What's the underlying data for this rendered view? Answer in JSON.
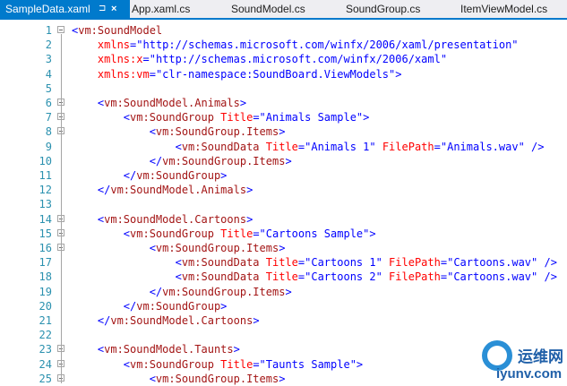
{
  "tabs": [
    {
      "label": "SampleData.xaml",
      "active": true
    },
    {
      "label": "App.xaml.cs",
      "active": false
    },
    {
      "label": "SoundModel.cs",
      "active": false
    },
    {
      "label": "SoundGroup.cs",
      "active": false
    },
    {
      "label": "ItemViewModel.cs",
      "active": false
    }
  ],
  "tab_icons": {
    "pin": "⊐",
    "close": "×"
  },
  "colors": {
    "accent": "#007acc",
    "line_number": "#2b91af",
    "tag": "#a31515",
    "attr": "#ff0000",
    "value": "#0000ff"
  },
  "lines": [
    {
      "n": "1",
      "fold": true,
      "tokens": [
        [
          "br",
          "<"
        ],
        [
          "tag",
          "vm:SoundModel"
        ]
      ]
    },
    {
      "n": "2",
      "fold": false,
      "tokens": [
        [
          "at",
          "    xmlns"
        ],
        [
          "eq",
          "="
        ],
        [
          "val",
          "\"http://schemas.microsoft.com/winfx/2006/xaml/presentation\""
        ]
      ]
    },
    {
      "n": "3",
      "fold": false,
      "tokens": [
        [
          "at",
          "    xmlns:x"
        ],
        [
          "eq",
          "="
        ],
        [
          "val",
          "\"http://schemas.microsoft.com/winfx/2006/xaml\""
        ]
      ]
    },
    {
      "n": "4",
      "fold": false,
      "tokens": [
        [
          "at",
          "    xmlns:vm"
        ],
        [
          "eq",
          "="
        ],
        [
          "val",
          "\"clr-namespace:SoundBoard.ViewModels\""
        ],
        [
          "br",
          ">"
        ]
      ]
    },
    {
      "n": "5",
      "fold": false,
      "tokens": []
    },
    {
      "n": "6",
      "fold": true,
      "tokens": [
        [
          "br",
          "    <"
        ],
        [
          "tag",
          "vm:SoundModel.Animals"
        ],
        [
          "br",
          ">"
        ]
      ]
    },
    {
      "n": "7",
      "fold": true,
      "tokens": [
        [
          "br",
          "        <"
        ],
        [
          "tag",
          "vm:SoundGroup"
        ],
        [
          "at",
          " Title"
        ],
        [
          "eq",
          "="
        ],
        [
          "val",
          "\"Animals Sample\""
        ],
        [
          "br",
          ">"
        ]
      ]
    },
    {
      "n": "8",
      "fold": true,
      "tokens": [
        [
          "br",
          "            <"
        ],
        [
          "tag",
          "vm:SoundGroup.Items"
        ],
        [
          "br",
          ">"
        ]
      ]
    },
    {
      "n": "9",
      "fold": false,
      "tokens": [
        [
          "br",
          "                <"
        ],
        [
          "tag",
          "vm:SoundData"
        ],
        [
          "at",
          " Title"
        ],
        [
          "eq",
          "="
        ],
        [
          "val",
          "\"Animals 1\""
        ],
        [
          "at",
          " FilePath"
        ],
        [
          "eq",
          "="
        ],
        [
          "val",
          "\"Animals.wav\""
        ],
        [
          "br",
          " />"
        ]
      ]
    },
    {
      "n": "10",
      "fold": false,
      "tokens": [
        [
          "br",
          "            </"
        ],
        [
          "tag",
          "vm:SoundGroup.Items"
        ],
        [
          "br",
          ">"
        ]
      ]
    },
    {
      "n": "11",
      "fold": false,
      "tokens": [
        [
          "br",
          "        </"
        ],
        [
          "tag",
          "vm:SoundGroup"
        ],
        [
          "br",
          ">"
        ]
      ]
    },
    {
      "n": "12",
      "fold": false,
      "tokens": [
        [
          "br",
          "    </"
        ],
        [
          "tag",
          "vm:SoundModel.Animals"
        ],
        [
          "br",
          ">"
        ]
      ]
    },
    {
      "n": "13",
      "fold": false,
      "tokens": []
    },
    {
      "n": "14",
      "fold": true,
      "tokens": [
        [
          "br",
          "    <"
        ],
        [
          "tag",
          "vm:SoundModel.Cartoons"
        ],
        [
          "br",
          ">"
        ]
      ]
    },
    {
      "n": "15",
      "fold": true,
      "tokens": [
        [
          "br",
          "        <"
        ],
        [
          "tag",
          "vm:SoundGroup"
        ],
        [
          "at",
          " Title"
        ],
        [
          "eq",
          "="
        ],
        [
          "val",
          "\"Cartoons Sample\""
        ],
        [
          "br",
          ">"
        ]
      ]
    },
    {
      "n": "16",
      "fold": true,
      "tokens": [
        [
          "br",
          "            <"
        ],
        [
          "tag",
          "vm:SoundGroup.Items"
        ],
        [
          "br",
          ">"
        ]
      ]
    },
    {
      "n": "17",
      "fold": false,
      "tokens": [
        [
          "br",
          "                <"
        ],
        [
          "tag",
          "vm:SoundData"
        ],
        [
          "at",
          " Title"
        ],
        [
          "eq",
          "="
        ],
        [
          "val",
          "\"Cartoons 1\""
        ],
        [
          "at",
          " FilePath"
        ],
        [
          "eq",
          "="
        ],
        [
          "val",
          "\"Cartoons.wav\""
        ],
        [
          "br",
          " />"
        ]
      ]
    },
    {
      "n": "18",
      "fold": false,
      "tokens": [
        [
          "br",
          "                <"
        ],
        [
          "tag",
          "vm:SoundData"
        ],
        [
          "at",
          " Title"
        ],
        [
          "eq",
          "="
        ],
        [
          "val",
          "\"Cartoons 2\""
        ],
        [
          "at",
          " FilePath"
        ],
        [
          "eq",
          "="
        ],
        [
          "val",
          "\"Cartoons.wav\""
        ],
        [
          "br",
          " />"
        ]
      ]
    },
    {
      "n": "19",
      "fold": false,
      "tokens": [
        [
          "br",
          "            </"
        ],
        [
          "tag",
          "vm:SoundGroup.Items"
        ],
        [
          "br",
          ">"
        ]
      ]
    },
    {
      "n": "20",
      "fold": false,
      "tokens": [
        [
          "br",
          "        </"
        ],
        [
          "tag",
          "vm:SoundGroup"
        ],
        [
          "br",
          ">"
        ]
      ]
    },
    {
      "n": "21",
      "fold": false,
      "tokens": [
        [
          "br",
          "    </"
        ],
        [
          "tag",
          "vm:SoundModel.Cartoons"
        ],
        [
          "br",
          ">"
        ]
      ]
    },
    {
      "n": "22",
      "fold": false,
      "tokens": []
    },
    {
      "n": "23",
      "fold": true,
      "tokens": [
        [
          "br",
          "    <"
        ],
        [
          "tag",
          "vm:SoundModel.Taunts"
        ],
        [
          "br",
          ">"
        ]
      ]
    },
    {
      "n": "24",
      "fold": true,
      "tokens": [
        [
          "br",
          "        <"
        ],
        [
          "tag",
          "vm:SoundGroup"
        ],
        [
          "at",
          " Title"
        ],
        [
          "eq",
          "="
        ],
        [
          "val",
          "\"Taunts Sample\""
        ],
        [
          "br",
          ">"
        ]
      ]
    },
    {
      "n": "25",
      "fold": true,
      "tokens": [
        [
          "br",
          "            <"
        ],
        [
          "tag",
          "vm:SoundGroup.Items"
        ],
        [
          "br",
          ">"
        ]
      ]
    }
  ],
  "watermark": {
    "cn": "运维网",
    "url": "iyunv.com"
  }
}
